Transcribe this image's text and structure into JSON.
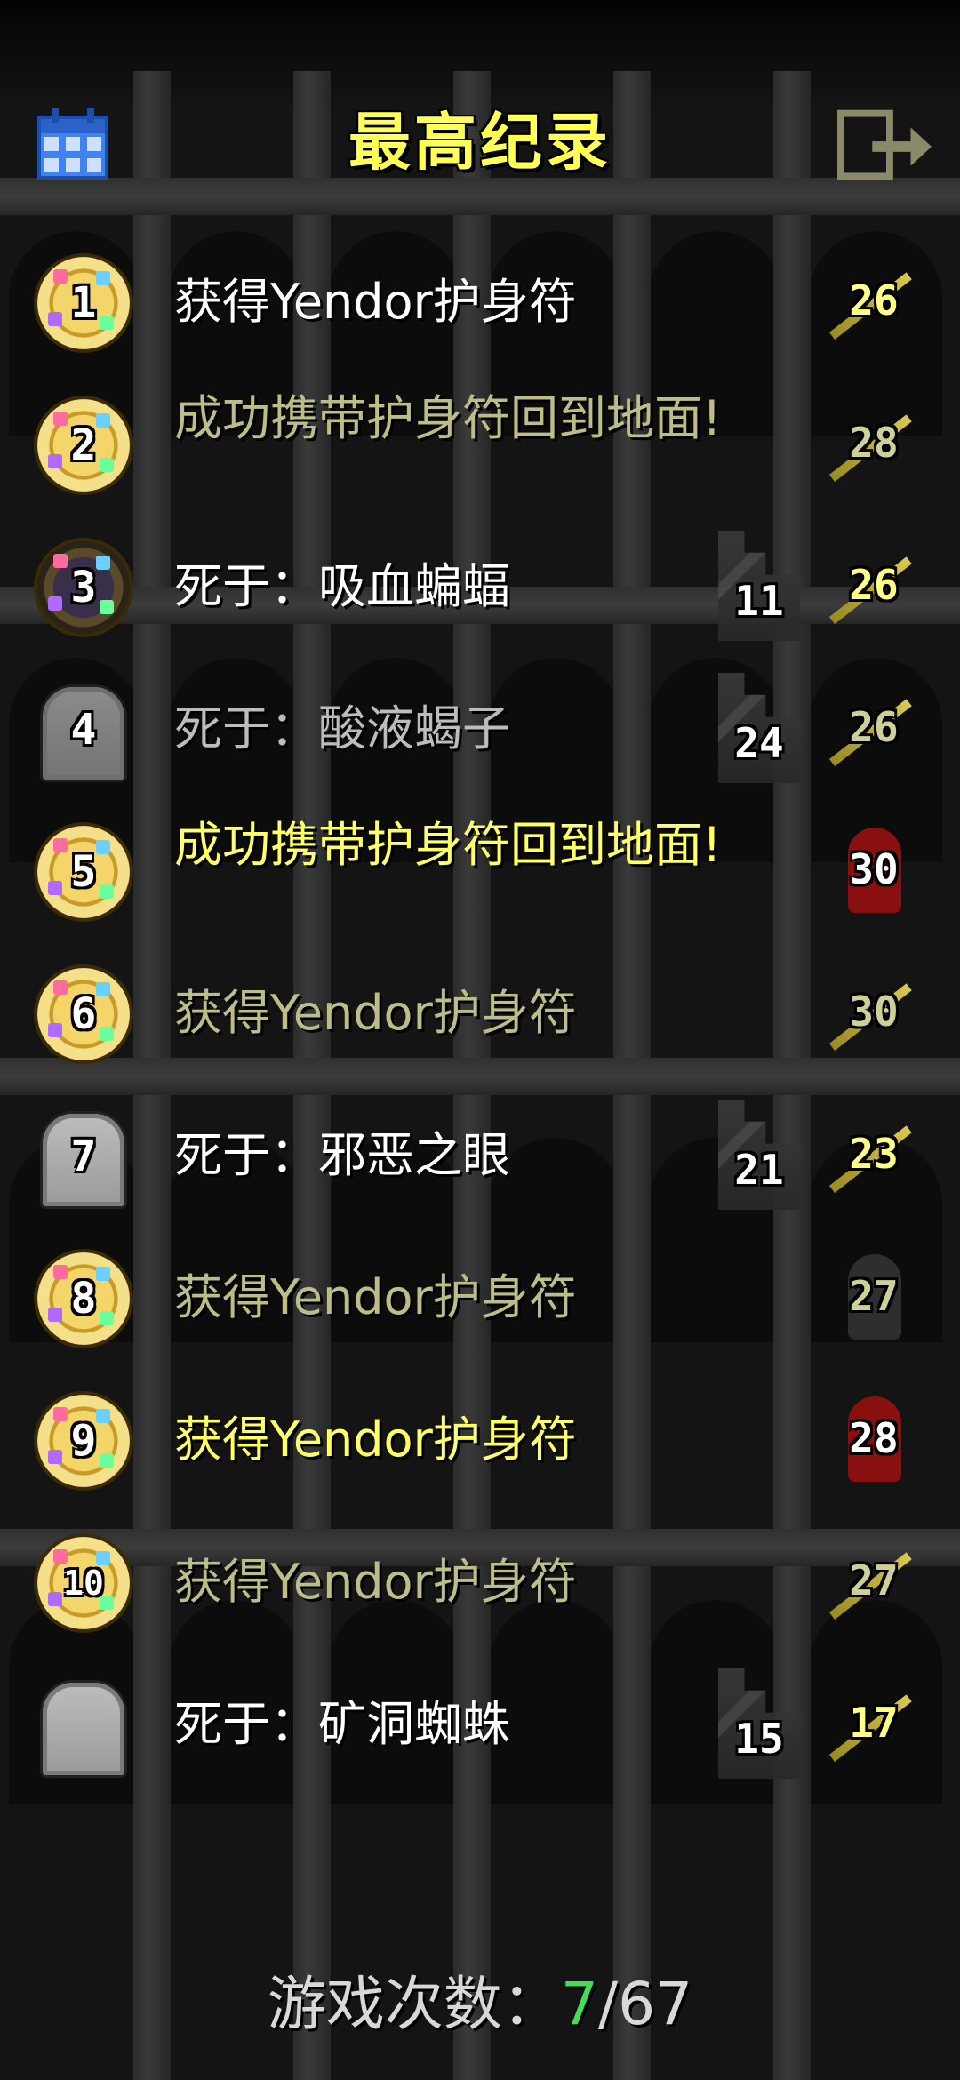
{
  "header": {
    "title": "最高纪录",
    "calendar_icon": "calendar-icon",
    "exit_icon": "exit-icon"
  },
  "colors": {
    "title": "#ffff55",
    "win_count": "#44dd55",
    "gold_medal": "#f3d56a",
    "tombstone": "#bdbdbd"
  },
  "records": [
    {
      "rank": "1",
      "badge": "medal",
      "text": "获得Yendor护身符",
      "style": "white",
      "depth": "",
      "level": "26",
      "level_icon": "sword-icon"
    },
    {
      "rank": "2",
      "badge": "medal",
      "text": "成功携带护身符回到地面!",
      "style": "dim-yellow",
      "depth": "",
      "level": "28",
      "level_icon": "sword-icon"
    },
    {
      "rank": "3",
      "badge": "medal-dark",
      "text": "死于：吸血蝙蝠",
      "style": "white",
      "depth": "11",
      "level": "26",
      "level_icon": "sword-icon"
    },
    {
      "rank": "4",
      "badge": "tombstone-dim",
      "text": "死于：酸液蝎子",
      "style": "dim",
      "depth": "24",
      "level": "26",
      "level_icon": "sword-icon"
    },
    {
      "rank": "5",
      "badge": "medal",
      "text": "成功携带护身符回到地面!",
      "style": "yellow",
      "depth": "",
      "level": "30",
      "level_icon": "helmet-icon"
    },
    {
      "rank": "6",
      "badge": "medal",
      "text": "获得Yendor护身符",
      "style": "dim-yellow",
      "depth": "",
      "level": "30",
      "level_icon": "sword-icon"
    },
    {
      "rank": "7",
      "badge": "tombstone",
      "text": "死于：邪恶之眼",
      "style": "white",
      "depth": "21",
      "level": "23",
      "level_icon": "sword-icon"
    },
    {
      "rank": "8",
      "badge": "medal",
      "text": "获得Yendor护身符",
      "style": "dim-yellow",
      "depth": "",
      "level": "27",
      "level_icon": "helmet-dark-icon"
    },
    {
      "rank": "9",
      "badge": "medal",
      "text": "获得Yendor护身符",
      "style": "yellow",
      "depth": "",
      "level": "28",
      "level_icon": "helmet-icon"
    },
    {
      "rank": "10",
      "badge": "medal",
      "text": "获得Yendor护身符",
      "style": "dim-yellow",
      "depth": "",
      "level": "27",
      "level_icon": "sword-icon"
    },
    {
      "rank": "",
      "badge": "tombstone",
      "text": "死于：矿洞蜘蛛",
      "style": "white",
      "depth": "15",
      "level": "17",
      "level_icon": "sword-icon"
    }
  ],
  "footer": {
    "label": "游戏次数：",
    "wins": "7",
    "total": "/67"
  }
}
